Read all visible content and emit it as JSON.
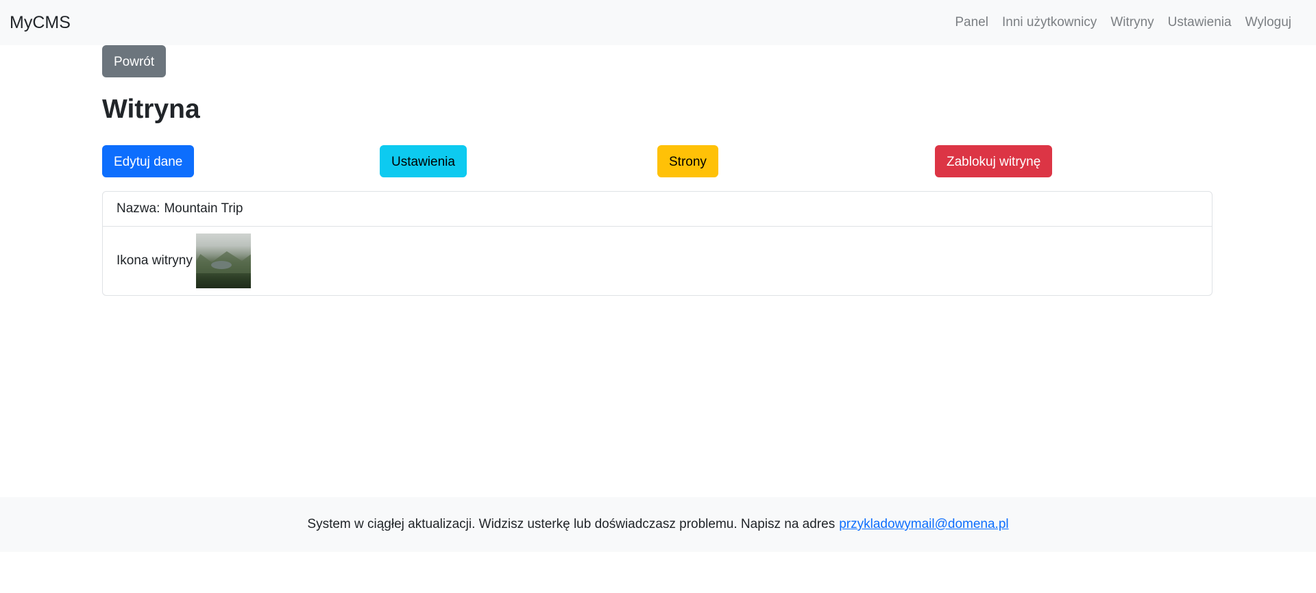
{
  "navbar": {
    "brand": "MyCMS",
    "links": [
      "Panel",
      "Inni użytkownicy",
      "Witryny",
      "Ustawienia",
      "Wyloguj"
    ]
  },
  "back_button": "Powrót",
  "page_title": "Witryna",
  "actions": {
    "edit": "Edytuj dane",
    "settings": "Ustawienia",
    "pages": "Strony",
    "block": "Zablokuj witrynę"
  },
  "details": {
    "name_label": "Nazwa:",
    "name_value": "Mountain Trip",
    "icon_label": "Ikona witryny"
  },
  "footer": {
    "text": "System w ciągłej aktualizacji. Widzisz usterkę lub doświadczasz problemu. Napisz na adres",
    "email": "przykladowymail@domena.pl"
  },
  "colors": {
    "primary": "#0d6efd",
    "info": "#0dcaf0",
    "warning": "#ffc107",
    "danger": "#dc3545",
    "secondary": "#6c757d"
  }
}
